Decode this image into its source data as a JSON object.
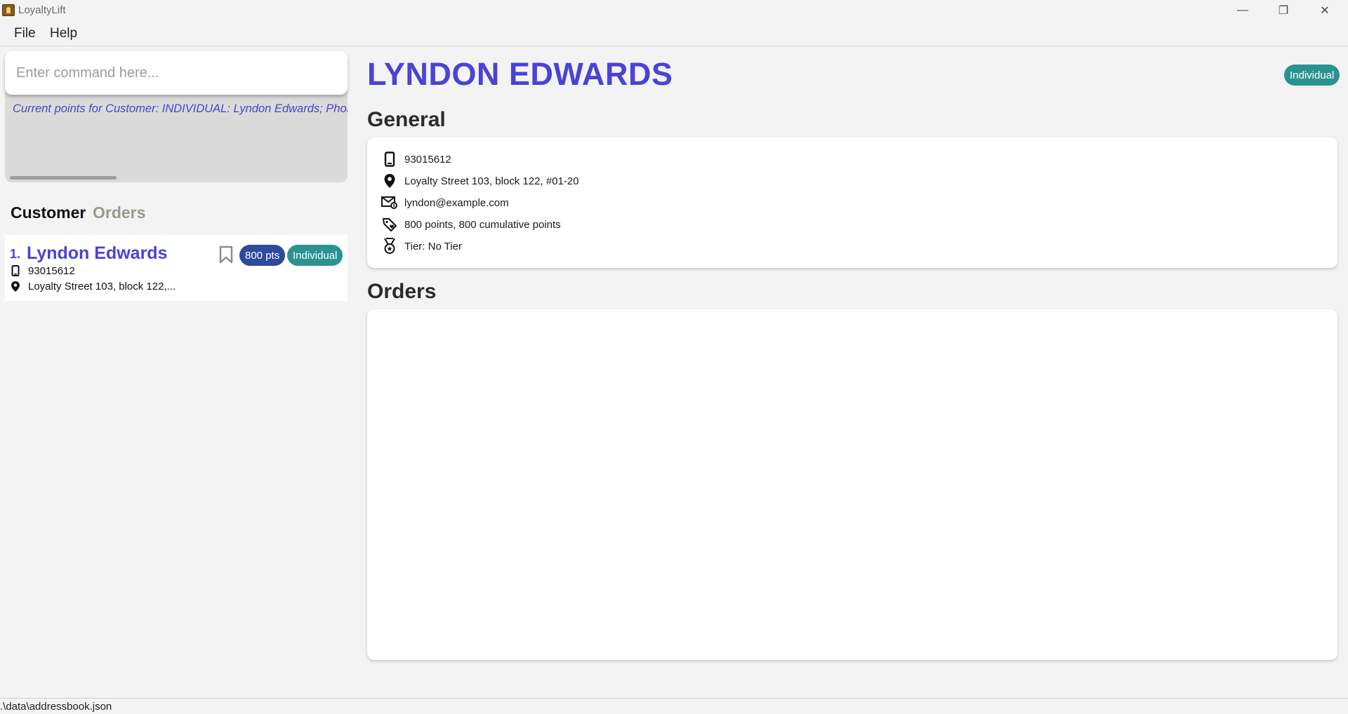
{
  "window": {
    "title": "LoyaltyLift",
    "minimize_glyph": "—",
    "maximize_glyph": "❐",
    "close_glyph": "✕"
  },
  "menu": {
    "file": "File",
    "help": "Help"
  },
  "command": {
    "placeholder": "Enter command here...",
    "value": ""
  },
  "result": {
    "text": "Current points for Customer: INDIVIDUAL: Lyndon Edwards; Phone"
  },
  "tabs": {
    "customer": "Customer",
    "orders": "Orders",
    "active": "Customer"
  },
  "customer_list": [
    {
      "index": "1.",
      "name": "Lyndon Edwards",
      "points_badge": "800 pts",
      "type_badge": "Individual",
      "phone": "93015612",
      "address": "Loyalty Street 103, block 122,..."
    }
  ],
  "detail": {
    "name": "LYNDON EDWARDS",
    "type_badge": "Individual",
    "general_heading": "General",
    "phone": "93015612",
    "address": "Loyalty Street 103, block 122, #01-20",
    "email": "lyndon@example.com",
    "points": "800 points, 800 cumulative points",
    "tier": "Tier: No Tier",
    "orders_heading": "Orders"
  },
  "status": {
    "path": ".\\data\\addressbook.json"
  },
  "colors": {
    "accent": "#4a43d6",
    "points_badge": "#2e4a9e",
    "type_badge": "#2a9390",
    "result_text": "#4b45c8"
  },
  "icons": {
    "phone": "phone-icon",
    "address": "location-pin-icon",
    "email": "mail-icon",
    "points": "tag-icon",
    "tier": "medal-icon",
    "bookmark": "bookmark-icon"
  }
}
